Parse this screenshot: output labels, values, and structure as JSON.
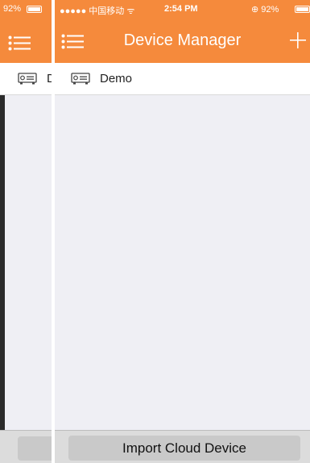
{
  "left_screen": {
    "status": {
      "battery_percent": "92%"
    },
    "device_row": {
      "partial_text": "D"
    }
  },
  "status_bar": {
    "signal": "●●●●● 中国移动 ᯤ",
    "time": "2:54 PM",
    "battery_percent": "92%"
  },
  "nav": {
    "title": "Device Manager",
    "menu_icon": "list-menu-icon",
    "add_icon": "plus-icon"
  },
  "devices": [
    {
      "name": "Demo",
      "icon": "dvr-device-icon"
    }
  ],
  "bottom": {
    "import_label": "Import Cloud Device"
  },
  "colors": {
    "accent": "#f58a3c",
    "background": "#efeff4",
    "row_background": "#ffffff",
    "bottom_bar": "#dcdcdc",
    "button": "#c9c9c9"
  }
}
